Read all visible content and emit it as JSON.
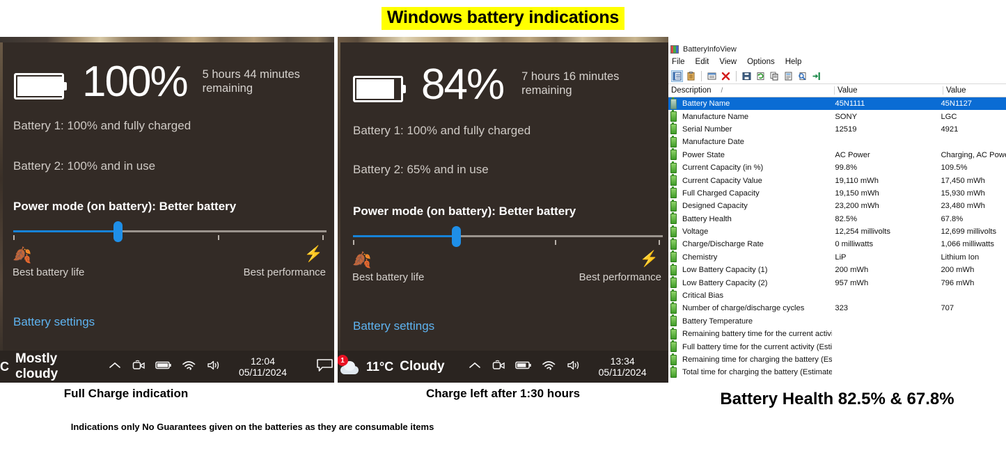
{
  "title": "Windows battery indications",
  "panels": [
    {
      "id": "left",
      "percent": "100%",
      "fill_ratio": 1.0,
      "remaining": "5 hours 44 minutes remaining",
      "battery1": "Battery 1: 100% and fully charged",
      "battery2": "Battery 2: 100% and in use",
      "power_mode": "Power mode (on battery): Better battery",
      "slider": {
        "value_pct": 33,
        "left_label": "Best battery life",
        "right_label": "Best performance"
      },
      "settings_link": "Battery settings",
      "taskbar": {
        "temperature": "C",
        "condition": "Mostly cloudy",
        "time": "12:04",
        "date": "05/11/2024",
        "badge": ""
      },
      "caption": "Full Charge indication"
    },
    {
      "id": "right",
      "percent": "84%",
      "fill_ratio": 0.84,
      "remaining": "7 hours 16 minutes remaining",
      "battery1": "Battery 1: 100% and fully charged",
      "battery2": "Battery 2: 65% and in use",
      "power_mode": "Power mode (on battery): Better battery",
      "slider": {
        "value_pct": 33,
        "left_label": "Best battery life",
        "right_label": "Best performance"
      },
      "settings_link": "Battery settings",
      "taskbar": {
        "temperature": "11°C",
        "condition": "Cloudy",
        "time": "13:34",
        "date": "05/11/2024",
        "badge": "1"
      },
      "caption": "Charge left after 1:30 hours"
    }
  ],
  "batteryinfoview": {
    "window_title": "BatteryInfoView",
    "menu": [
      "File",
      "Edit",
      "View",
      "Options",
      "Help"
    ],
    "toolbar_icons": [
      "properties-view-icon",
      "clipboard-icon",
      "html-report-icon",
      "delete-icon",
      "save-icon",
      "refresh-icon",
      "copy-icon",
      "properties-icon",
      "find-icon",
      "exit-icon"
    ],
    "columns": [
      "Description",
      "Value",
      "Value"
    ],
    "sort_indicator": "/",
    "rows": [
      {
        "description": "Battery Name",
        "v1": "45N1111",
        "v2": "45N1127",
        "selected": true
      },
      {
        "description": "Manufacture Name",
        "v1": "SONY",
        "v2": "LGC",
        "selected": false
      },
      {
        "description": "Serial Number",
        "v1": "12519",
        "v2": "4921",
        "selected": false
      },
      {
        "description": "Manufacture Date",
        "v1": "",
        "v2": "",
        "selected": false
      },
      {
        "description": "Power State",
        "v1": "AC Power",
        "v2": "Charging, AC Power",
        "selected": false
      },
      {
        "description": "Current Capacity (in %)",
        "v1": "99.8%",
        "v2": "109.5%",
        "selected": false
      },
      {
        "description": "Current Capacity Value",
        "v1": "19,110 mWh",
        "v2": "17,450 mWh",
        "selected": false
      },
      {
        "description": "Full Charged Capacity",
        "v1": "19,150 mWh",
        "v2": "15,930 mWh",
        "selected": false
      },
      {
        "description": "Designed Capacity",
        "v1": "23,200 mWh",
        "v2": "23,480 mWh",
        "selected": false
      },
      {
        "description": "Battery Health",
        "v1": "82.5%",
        "v2": "67.8%",
        "selected": false
      },
      {
        "description": "Voltage",
        "v1": "12,254 millivolts",
        "v2": "12,699 millivolts",
        "selected": false
      },
      {
        "description": "Charge/Discharge Rate",
        "v1": "0 milliwatts",
        "v2": "1,066 milliwatts",
        "selected": false
      },
      {
        "description": "Chemistry",
        "v1": "LiP",
        "v2": "Lithium Ion",
        "selected": false
      },
      {
        "description": "Low Battery Capacity (1)",
        "v1": "200 mWh",
        "v2": "200 mWh",
        "selected": false
      },
      {
        "description": "Low Battery Capacity (2)",
        "v1": "957 mWh",
        "v2": "796 mWh",
        "selected": false
      },
      {
        "description": "Critical Bias",
        "v1": "",
        "v2": "",
        "selected": false
      },
      {
        "description": "Number of charge/discharge cycles",
        "v1": "323",
        "v2": "707",
        "selected": false
      },
      {
        "description": "Battery Temperature",
        "v1": "",
        "v2": "",
        "selected": false
      },
      {
        "description": "Remaining battery time for the current activity (Est...",
        "v1": "",
        "v2": "",
        "selected": false
      },
      {
        "description": "Full battery time for the current activity (Estimated)",
        "v1": "",
        "v2": "",
        "selected": false
      },
      {
        "description": "Remaining time for charging the battery (Estimated)",
        "v1": "",
        "v2": "",
        "selected": false
      },
      {
        "description": "Total  time for charging the battery (Estimated)",
        "v1": "",
        "v2": "",
        "selected": false
      }
    ],
    "caption": "Battery Health 82.5% & 67.8%"
  },
  "disclaimer": "Indications only No Guarantees given on the batteries as they are consumable items",
  "colors": {
    "highlight": "#ffff00",
    "panel_bg": "#332b26",
    "taskbar_bg": "#2a2420",
    "accent_blue": "#1f8fe8",
    "link_blue": "#5eb3f0",
    "row_select": "#0a6cd4",
    "green_battery": "#3e9b27"
  }
}
